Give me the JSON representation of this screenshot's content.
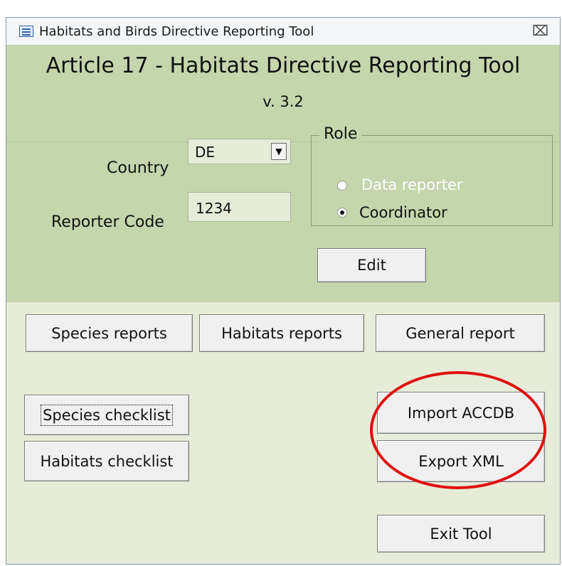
{
  "window": {
    "title": "Habitats and Birds Directive Reporting Tool",
    "close_glyph": "⌧"
  },
  "header": {
    "title": "Article 17 - Habitats Directive Reporting Tool",
    "version": "v. 3.2"
  },
  "settings": {
    "country_label": "Country",
    "country_value": "DE",
    "reporter_code_label": "Reporter Code",
    "reporter_code_value": "1234",
    "role_legend": "Role",
    "role_options": [
      {
        "label": "Data reporter",
        "selected": false,
        "enabled": false
      },
      {
        "label": "Coordinator",
        "selected": true,
        "enabled": true
      }
    ],
    "edit_button": "Edit"
  },
  "actions": {
    "species_reports": "Species reports",
    "habitats_reports": "Habitats reports",
    "general_report": "General report",
    "species_checklist": "Species checklist",
    "habitats_checklist": "Habitats checklist",
    "import_accdb": "Import ACCDB",
    "export_xml": "Export XML",
    "exit_tool": "Exit Tool"
  },
  "colors": {
    "header_bg": "#c5d6ac",
    "body_bg": "#e6ecd8",
    "highlight_ellipse": "#e01010",
    "disabled_text": "#ffffff"
  },
  "icons": {
    "app": "form-icon",
    "close": "close-icon",
    "dropdown": "chevron-down-icon"
  }
}
